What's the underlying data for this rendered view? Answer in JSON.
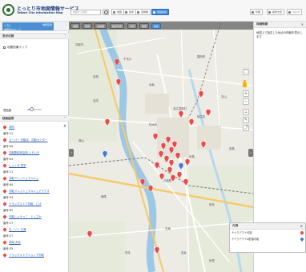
{
  "header": {
    "title": "とっとり市地図情報サービス",
    "subtitle": "Tottori City Information Map",
    "search_placeholder": "地図から検索",
    "tools": [
      {
        "label": "地図"
      },
      {
        "label": "住所"
      },
      {
        "label": "目標物"
      },
      {
        "label": "施設情報"
      }
    ],
    "right_tools": [
      {
        "label": "印刷"
      },
      {
        "label": "操作方法"
      },
      {
        "label": "ヘルプ"
      }
    ]
  },
  "sidebar": {
    "theme_line1": "くらし",
    "theme_line2": "地震防災マップ",
    "theme_right": "地図切替",
    "layer_section": "表示切替",
    "layer_item": "地震知識マップ",
    "opacity_label": "透過度",
    "opacity_value": 0.3,
    "results_section": "検索結果"
  },
  "results": [
    {
      "name": "消防",
      "number": "番号:12",
      "pin": "red"
    },
    {
      "name": "スーパー 鳥取店　鳥取センター",
      "number": "番号:06",
      "pin": "red"
    },
    {
      "name": "鳥取駅前商店街 いろいろ",
      "number": "番号:63",
      "pin": "red"
    },
    {
      "name": "しょくみ 見学",
      "number": "番号:11",
      "pin": "red"
    },
    {
      "name": "鳥取フレッシュマルシェ",
      "number": "番号:64",
      "pin": "red"
    },
    {
      "name": "鳥取フレッシュマルシェアクアズ",
      "number": "番号:54",
      "pin": "red"
    },
    {
      "name": "ドラッグストア鳥取　しけ",
      "number": "番号:82",
      "pin": "red"
    },
    {
      "name": "鳥取しょうっこ　とくさわ",
      "number": "番号:17",
      "pin": "red"
    },
    {
      "name": "ローソン 古海",
      "number": "番号:27",
      "pin": "red"
    },
    {
      "name": "地域 大地",
      "number": "番号:35",
      "pin": "red"
    },
    {
      "name": "ドラッグストアショップ鳥取",
      "number": "",
      "pin": "red"
    }
  ],
  "map": {
    "nav_buttons": [
      {
        "label": "地図"
      },
      {
        "label": "写真"
      },
      {
        "label": "白地図"
      },
      {
        "label": "航空写真"
      },
      {
        "label": "背景"
      },
      {
        "label": "地形"
      },
      {
        "label": "街区"
      }
    ],
    "place_labels": [
      "鳥取市",
      "千代川",
      "湖山",
      "吉成",
      "鳥取駅",
      "材木町",
      "末広温泉町",
      "安長",
      "古海",
      "相生町",
      "浜坂",
      "田島",
      "秋里",
      "徳尾",
      "覚寺",
      "国府町",
      "卯垣",
      "宮長",
      "丸山",
      "岩倉"
    ],
    "controls": {
      "fullscreen": "⛶",
      "zoom_in": "+",
      "zoom_out": "−"
    }
  },
  "right_panel": {
    "title": "詳細情報",
    "text": "地図上で指定した地点の情報を表示します"
  },
  "legend": {
    "title": "凡例",
    "rows": [
      {
        "label": "テイクアウト可能",
        "color": "#e94a4a"
      },
      {
        "label": "テイクアウト&配達可能",
        "color": "#4a77d6"
      }
    ]
  },
  "colors": {
    "accent": "#4a8fd3",
    "pin_red": "#e94a4a",
    "pin_blue": "#4a77d6",
    "river": "#9cc8e6",
    "road_major": "#f6c96a"
  }
}
